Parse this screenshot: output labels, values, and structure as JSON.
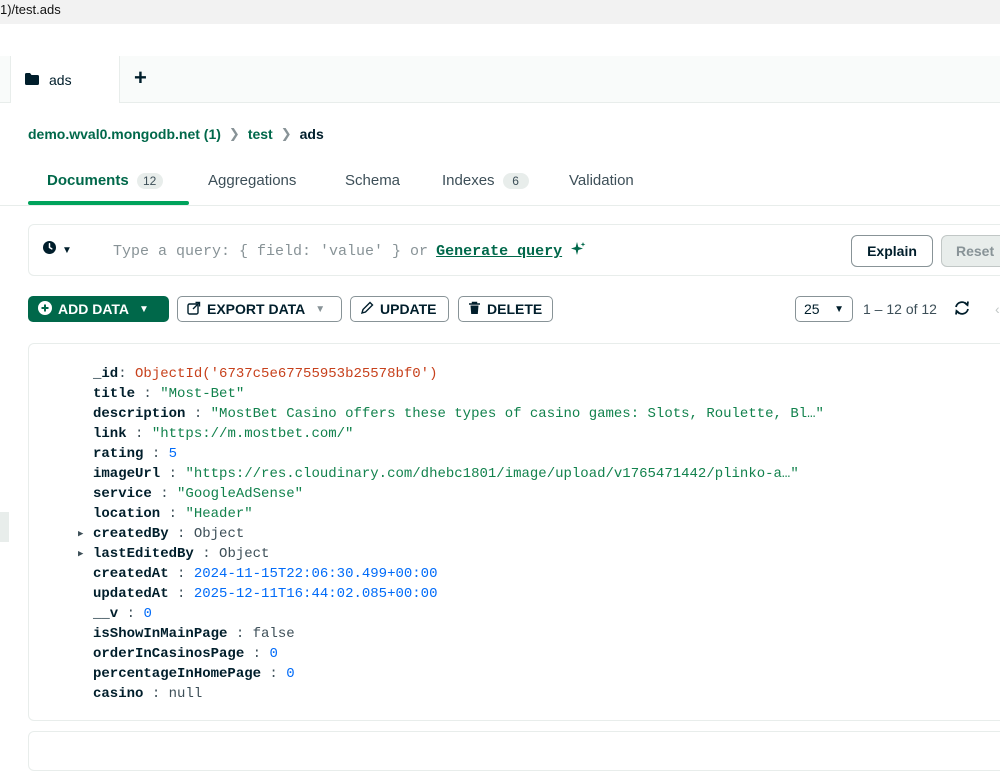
{
  "window": {
    "title": "1)/test.ads"
  },
  "tabs": [
    {
      "label": "ads",
      "icon": "folder-icon"
    }
  ],
  "breadcrumb": {
    "connection": "demo.wval0.mongodb.net (1)",
    "database": "test",
    "collection": "ads"
  },
  "subtabs": {
    "documents": {
      "label": "Documents",
      "count": "12"
    },
    "aggregations": {
      "label": "Aggregations"
    },
    "schema": {
      "label": "Schema"
    },
    "indexes": {
      "label": "Indexes",
      "count": "6"
    },
    "validation": {
      "label": "Validation"
    }
  },
  "query": {
    "placeholder": "Type a query: { field: 'value' } or",
    "generate_label": "Generate query",
    "explain_label": "Explain",
    "reset_label": "Reset"
  },
  "toolbar": {
    "add_data": "ADD DATA",
    "export_data": "EXPORT DATA",
    "update": "UPDATE",
    "delete": "DELETE"
  },
  "pagination": {
    "page_size": "25",
    "range": "1 – 12 of 12"
  },
  "document": {
    "fields": [
      {
        "key": "_id",
        "value": "ObjectId('6737c5e67755953b25578bf0')",
        "type": "oid"
      },
      {
        "key": "title",
        "value": "\"Most-Bet\"",
        "type": "str"
      },
      {
        "key": "description",
        "value": "\"MostBet Casino offers these types of casino games: Slots, Roulette, Bl…\"",
        "type": "str"
      },
      {
        "key": "link",
        "value": "\"https://m.mostbet.com/\"",
        "type": "str"
      },
      {
        "key": "rating",
        "value": "5",
        "type": "num"
      },
      {
        "key": "imageUrl",
        "value": "\"https://res.cloudinary.com/dhebc1801/image/upload/v1765471442/plinko-a…\"",
        "type": "str"
      },
      {
        "key": "service",
        "value": "\"GoogleAdSense\"",
        "type": "str"
      },
      {
        "key": "location",
        "value": "\"Header\"",
        "type": "str"
      },
      {
        "key": "createdBy",
        "value": "Object",
        "type": "plain",
        "expandable": true
      },
      {
        "key": "lastEditedBy",
        "value": "Object",
        "type": "plain",
        "expandable": true
      },
      {
        "key": "createdAt",
        "value": "2024-11-15T22:06:30.499+00:00",
        "type": "num"
      },
      {
        "key": "updatedAt",
        "value": "2025-12-11T16:44:02.085+00:00",
        "type": "num"
      },
      {
        "key": "__v",
        "value": "0",
        "type": "num"
      },
      {
        "key": "isShowInMainPage",
        "value": "false",
        "type": "plain"
      },
      {
        "key": "orderInCasinosPage",
        "value": "0",
        "type": "num"
      },
      {
        "key": "percentageInHomePage",
        "value": "0",
        "type": "num"
      },
      {
        "key": "casino",
        "value": "null",
        "type": "plain"
      }
    ]
  },
  "colors": {
    "accent": "#00684a",
    "underline": "#00a35c",
    "objectid": "#c7411c",
    "string": "#12824d",
    "number": "#016bf8"
  }
}
